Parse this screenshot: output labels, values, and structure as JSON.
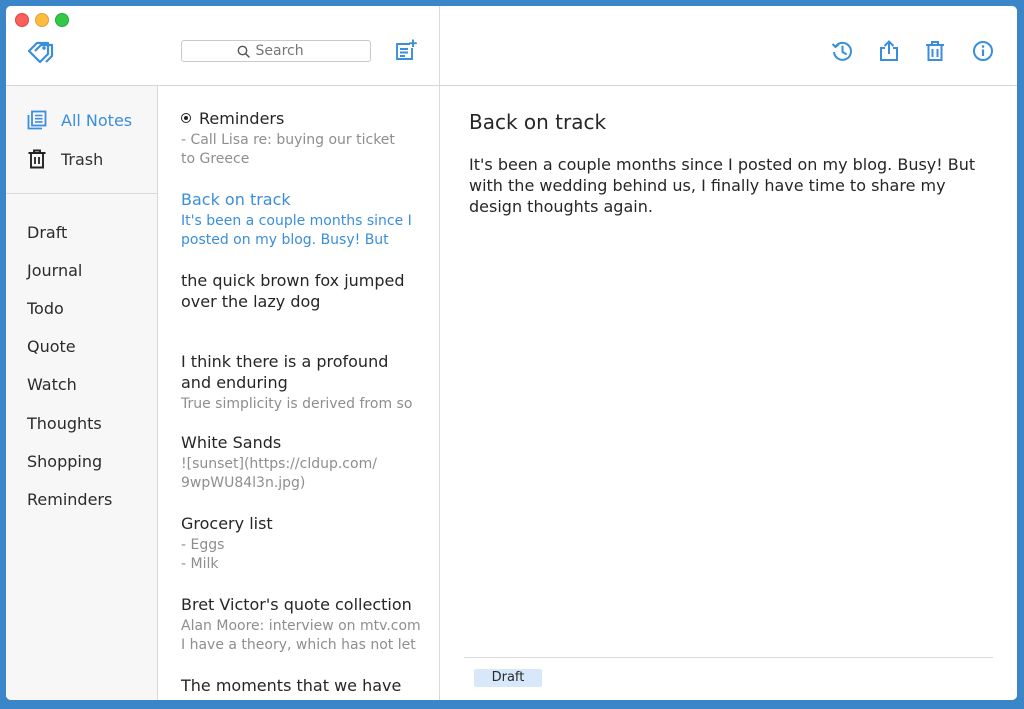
{
  "toolbar": {
    "search_placeholder": "Search",
    "icons": [
      "tag-logo-icon",
      "search-icon",
      "new-note-icon",
      "history-icon",
      "share-icon",
      "trash-icon",
      "info-icon"
    ]
  },
  "sidebar": {
    "all_notes": "All Notes",
    "trash": "Trash",
    "tags": [
      "Draft",
      "Journal",
      "Todo",
      "Quote",
      "Watch",
      "Thoughts",
      "Shopping",
      "Reminders"
    ]
  },
  "notes": [
    {
      "title": "Reminders",
      "body1": "- Call Lisa re: buying our ticket",
      "body2": "to Greece",
      "pinned": true
    },
    {
      "title": "Back on track",
      "body1": "It's been a couple months since I",
      "body2": "posted on my blog. Busy! But",
      "selected": true
    },
    {
      "title1": "the quick brown fox jumped",
      "title2": "over the lazy dog"
    },
    {
      "title1": "I think there is a profound",
      "title2": "and enduring",
      "body1": "True simplicity is derived from so"
    },
    {
      "title": "White Sands",
      "body1": "![sunset](https://cldup.com/",
      "body2": "9wpWU84l3n.jpg)"
    },
    {
      "title": "Grocery list",
      "body1": "- Eggs",
      "body2": "- Milk"
    },
    {
      "title": "Bret Victor's quote collection",
      "body1": "Alan Moore: interview on mtv.com",
      "body2": "I have a theory, which has not let"
    },
    {
      "title": "The moments that we have"
    }
  ],
  "editor": {
    "title": "Back on track",
    "body": "It's been a couple months since I posted on my blog. Busy! But with the wedding behind us, I finally have time to share my design thoughts again.",
    "tag": "Draft"
  },
  "colors": {
    "accent": "#3a8edb",
    "background": "#3b86c9"
  }
}
